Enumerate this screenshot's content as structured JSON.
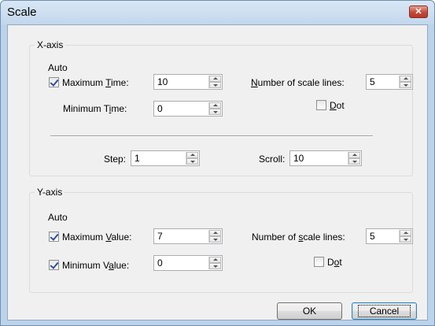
{
  "window": {
    "title": "Scale",
    "close_glyph": "✕"
  },
  "x_axis": {
    "legend": "X-axis",
    "auto_label": "Auto",
    "max": {
      "checked": true,
      "label_pre": "Maximum ",
      "label_u": "T",
      "label_post": "ime:",
      "value": "10"
    },
    "min": {
      "label_pre": "Minimum T",
      "label_u": "i",
      "label_post": "me:",
      "value": "0"
    },
    "scale_lines": {
      "label_pre": "",
      "label_u": "N",
      "label_post": "umber of scale lines:",
      "value": "5"
    },
    "dot": {
      "checked": false,
      "label_u": "D",
      "label_post": "ot"
    },
    "step": {
      "label": "Step:",
      "value": "1"
    },
    "scroll": {
      "label": "Scroll:",
      "value": "10"
    }
  },
  "y_axis": {
    "legend": "Y-axis",
    "auto_label": "Auto",
    "max": {
      "checked": true,
      "label_pre": "Maximum ",
      "label_u": "V",
      "label_post": "alue:",
      "value": "7"
    },
    "min": {
      "checked": true,
      "label_pre": "Minimum V",
      "label_u": "a",
      "label_post": "lue:",
      "value": "0"
    },
    "scale_lines": {
      "label_pre": "Number of ",
      "label_u": "s",
      "label_post": "cale lines:",
      "value": "5"
    },
    "dot": {
      "checked": false,
      "label_pre": "D",
      "label_u": "o",
      "label_post": "t"
    }
  },
  "buttons": {
    "ok": "OK",
    "cancel": "Cancel"
  }
}
